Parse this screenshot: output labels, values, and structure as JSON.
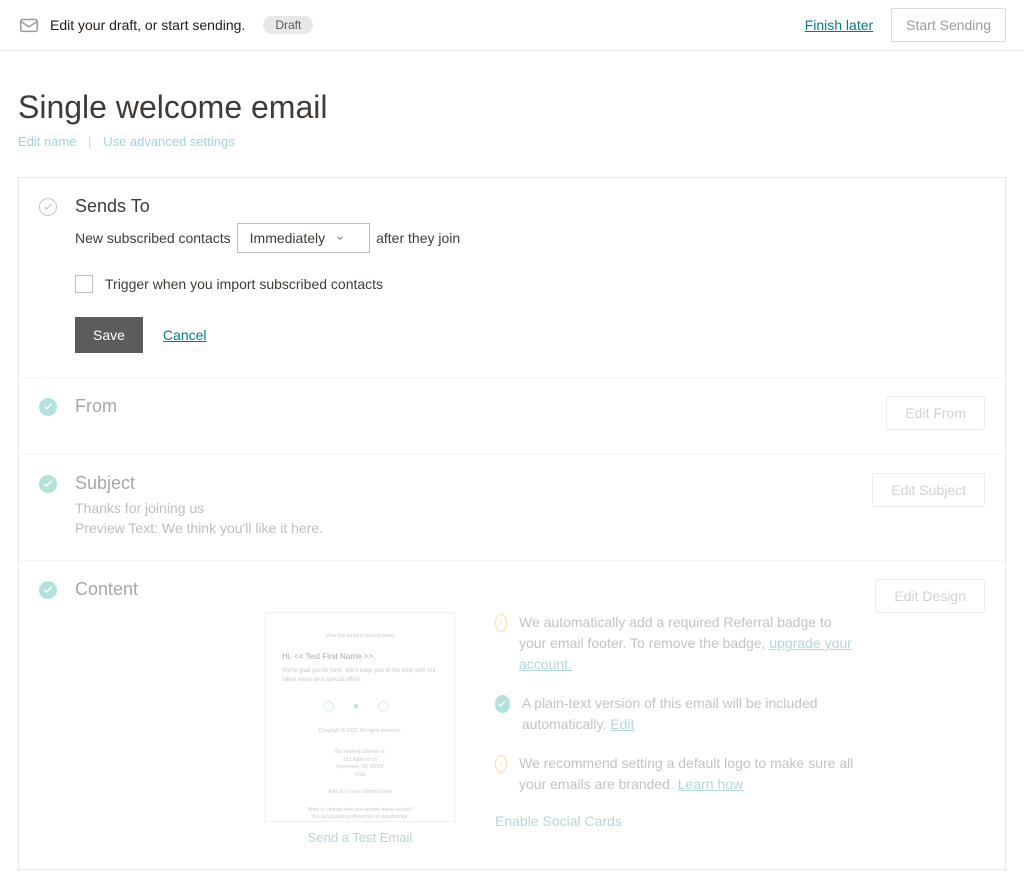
{
  "topbar": {
    "title": "Edit your draft, or start sending.",
    "badge": "Draft",
    "finish_label": "Finish later",
    "start_label": "Start Sending"
  },
  "header": {
    "title": "Single welcome email",
    "edit_name": "Edit name",
    "advanced": "Use advanced settings"
  },
  "sends_to": {
    "title": "Sends To",
    "pre": "New subscribed contacts",
    "select_value": "Immediately",
    "post": "after they join",
    "trigger": "Trigger when you import subscribed contacts",
    "save": "Save",
    "cancel": "Cancel"
  },
  "from": {
    "title": "From",
    "edit": "Edit From"
  },
  "subject": {
    "title": "Subject",
    "line": "Thanks for joining us",
    "preview": "Preview Text: We think you'll like it here.",
    "edit": "Edit Subject"
  },
  "content": {
    "title": "Content",
    "edit": "Edit Design",
    "send_test": "Send a Test Email",
    "thumb": {
      "greeting": "Hi, << Test First Name >>,",
      "intro": "We're glad you're here. We'll keep you in the loop with our latest news and special offers."
    },
    "notes": {
      "referral": "We automatically add a required Referral badge to your email footer. To remove the badge, ",
      "referral_link": "upgrade your account.",
      "plaintext": "A plain-text version of this email will be included automatically. ",
      "plaintext_link": "Edit",
      "logo": "We recommend setting a default logo to make sure all your emails are branded. ",
      "logo_link": "Learn how",
      "social_cards": "Enable Social Cards"
    }
  }
}
